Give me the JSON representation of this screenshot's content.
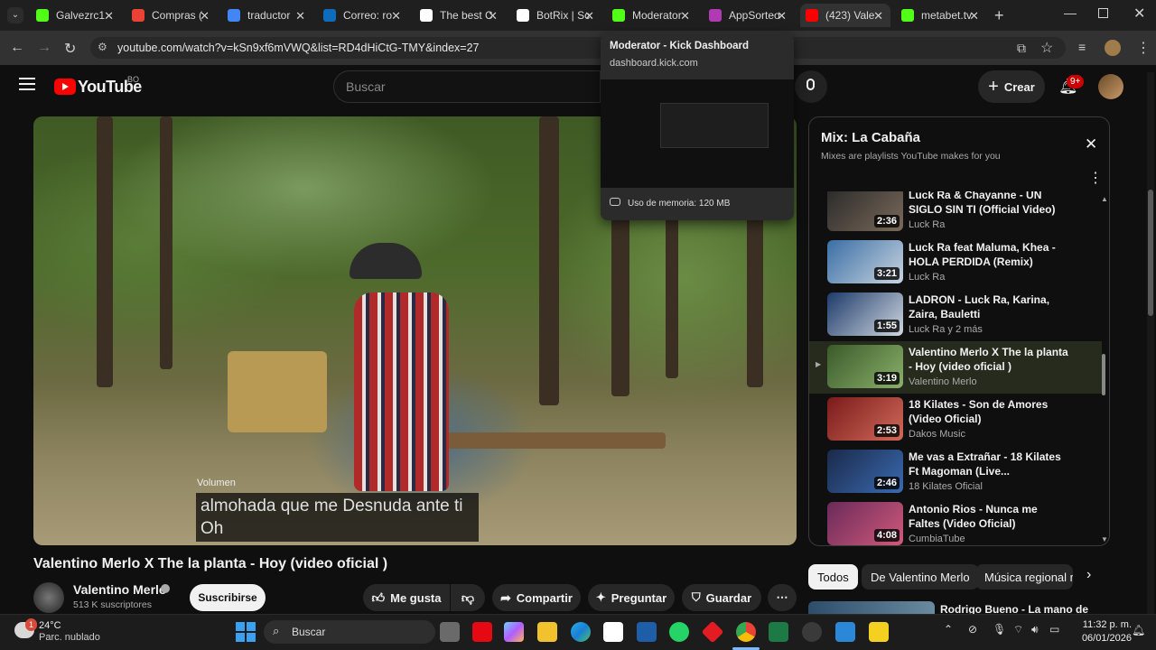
{
  "browser": {
    "tabs": [
      {
        "label": "Galvezrc1",
        "icon": "kick-icon",
        "color": "#53fc18"
      },
      {
        "label": "Compras (",
        "icon": "gmail-icon",
        "color": "#ea4335"
      },
      {
        "label": "traductor",
        "icon": "google-icon",
        "color": "#4285f4"
      },
      {
        "label": "Correo: ro",
        "icon": "outlook-icon",
        "color": "#0f6cbd"
      },
      {
        "label": "The best C",
        "icon": "github-icon",
        "color": "#ffffff"
      },
      {
        "label": "BotRix | Sc",
        "icon": "github-icon",
        "color": "#ffffff"
      },
      {
        "label": "Moderator",
        "icon": "kick-icon",
        "color": "#53fc18"
      },
      {
        "label": "AppSorteo",
        "icon": "appsorteo-icon",
        "color": "#b03ab4"
      },
      {
        "label": "(423) Vale",
        "icon": "youtube-icon",
        "color": "#ff0000"
      },
      {
        "label": "metabet.tv",
        "icon": "kick-icon",
        "color": "#53fc18"
      }
    ],
    "url": "youtube.com/watch?v=kSn9xf6mVWQ&list=RD4dHiCtG-TMY&index=27"
  },
  "popover": {
    "title": "Moderator - Kick Dashboard",
    "domain": "dashboard.kick.com",
    "memory": "Uso de memoria: 120 MB"
  },
  "youtube": {
    "logo": "YouTube",
    "country": "BO",
    "search_placeholder": "Buscar",
    "create_label": "Crear",
    "notif_badge": "9+"
  },
  "video": {
    "caption": "almohada que me Desnuda ante ti Oh",
    "volume_label": "Volumen",
    "title": "Valentino Merlo X The la planta - Hoy (video oficial )",
    "channel": "Valentino Merlo",
    "subscribers": "513 K suscriptores",
    "subscribe": "Suscribirse",
    "actions": {
      "like": "Me gusta",
      "share": "Compartir",
      "ask": "Preguntar",
      "save": "Guardar"
    }
  },
  "playlist": {
    "title": "Mix: La Cabaña",
    "subtitle": "Mixes are playlists YouTube makes for you",
    "items": [
      {
        "title": "Luck Ra & Chayanne - UN SIGLO SIN TI (Official Video)",
        "channel": "Luck Ra",
        "duration": "2:36"
      },
      {
        "title": "Luck Ra feat Maluma, Khea - HOLA PERDIDA (Remix)",
        "channel": "Luck Ra",
        "duration": "3:21"
      },
      {
        "title": "LADRON - Luck Ra, Karina, Zaira, Bauletti",
        "channel": "Luck Ra y 2 más",
        "duration": "1:55"
      },
      {
        "title": "Valentino Merlo X The la planta - Hoy (video oficial )",
        "channel": "Valentino Merlo",
        "duration": "3:19"
      },
      {
        "title": "18 Kilates - Son de Amores (Video Oficial)",
        "channel": "Dakos Music",
        "duration": "2:53"
      },
      {
        "title": "Me vas a Extrañar - 18 Kilates Ft Magoman (Live...",
        "channel": "18 Kilates Oficial",
        "duration": "2:46"
      },
      {
        "title": "Antonio Rios - Nunca me Faltes (Video Oficial)",
        "channel": "CumbiaTube",
        "duration": "4:08"
      }
    ]
  },
  "chips": [
    "Todos",
    "De Valentino Merlo",
    "Música regional m"
  ],
  "next_video": {
    "title": "Rodrigo Bueno - La mano de"
  },
  "taskbar": {
    "weather_temp": "24°C",
    "weather_desc": "Parc. nublado",
    "weather_badge": "1",
    "search": "Buscar",
    "time": "11:32 p. m.",
    "date": "06/01/2026"
  }
}
